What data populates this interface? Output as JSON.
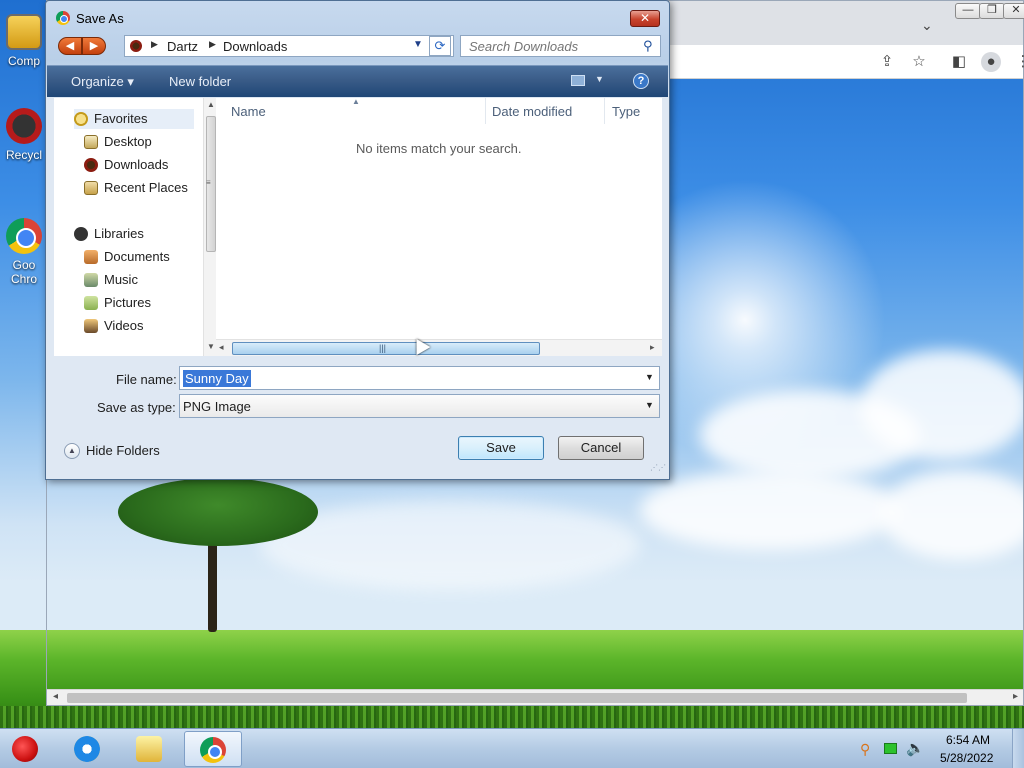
{
  "desktop": {
    "icons": [
      {
        "label": "Comp"
      },
      {
        "label": "Recycl"
      },
      {
        "label": "Goo\nChro"
      }
    ]
  },
  "browser": {
    "controls": {
      "minimize": "—",
      "restore": "❐",
      "close": "✕"
    },
    "tabs_dropdown": "⌄"
  },
  "dialog": {
    "title": "Save As",
    "close_label": "✕",
    "address": {
      "crumbs": [
        "Dartz",
        "Downloads"
      ]
    },
    "search": {
      "placeholder": "Search Downloads"
    },
    "command_bar": {
      "organize": "Organize ▾",
      "new_folder": "New folder",
      "help": "?"
    },
    "nav_pane": {
      "favorites": "Favorites",
      "favorite_items": [
        "Desktop",
        "Downloads",
        "Recent Places"
      ],
      "libraries": "Libraries",
      "library_items": [
        "Documents",
        "Music",
        "Pictures",
        "Videos"
      ]
    },
    "file_list": {
      "columns": [
        "Name",
        "Date modified",
        "Type"
      ],
      "empty_message": "No items match your search."
    },
    "form": {
      "file_name_label": "File name:",
      "file_name_value": "Sunny Day",
      "save_type_label": "Save as type:",
      "save_type_value": "PNG Image"
    },
    "hide_folders": "Hide Folders",
    "buttons": {
      "save": "Save",
      "cancel": "Cancel"
    }
  },
  "taskbar": {
    "time": "6:54 AM",
    "date": "5/28/2022"
  },
  "colors": {
    "command_bar": "#3a5c88",
    "selection": "#3a78d8",
    "dialog_close": "#c8432d"
  },
  "icons": [
    "chrome-icon",
    "back-arrow-icon",
    "forward-arrow-icon",
    "refresh-icon",
    "search-icon",
    "help-icon",
    "star-icon",
    "folder-icon",
    "chevron-down-icon",
    "ie-icon",
    "speaker-icon",
    "network-icon"
  ]
}
